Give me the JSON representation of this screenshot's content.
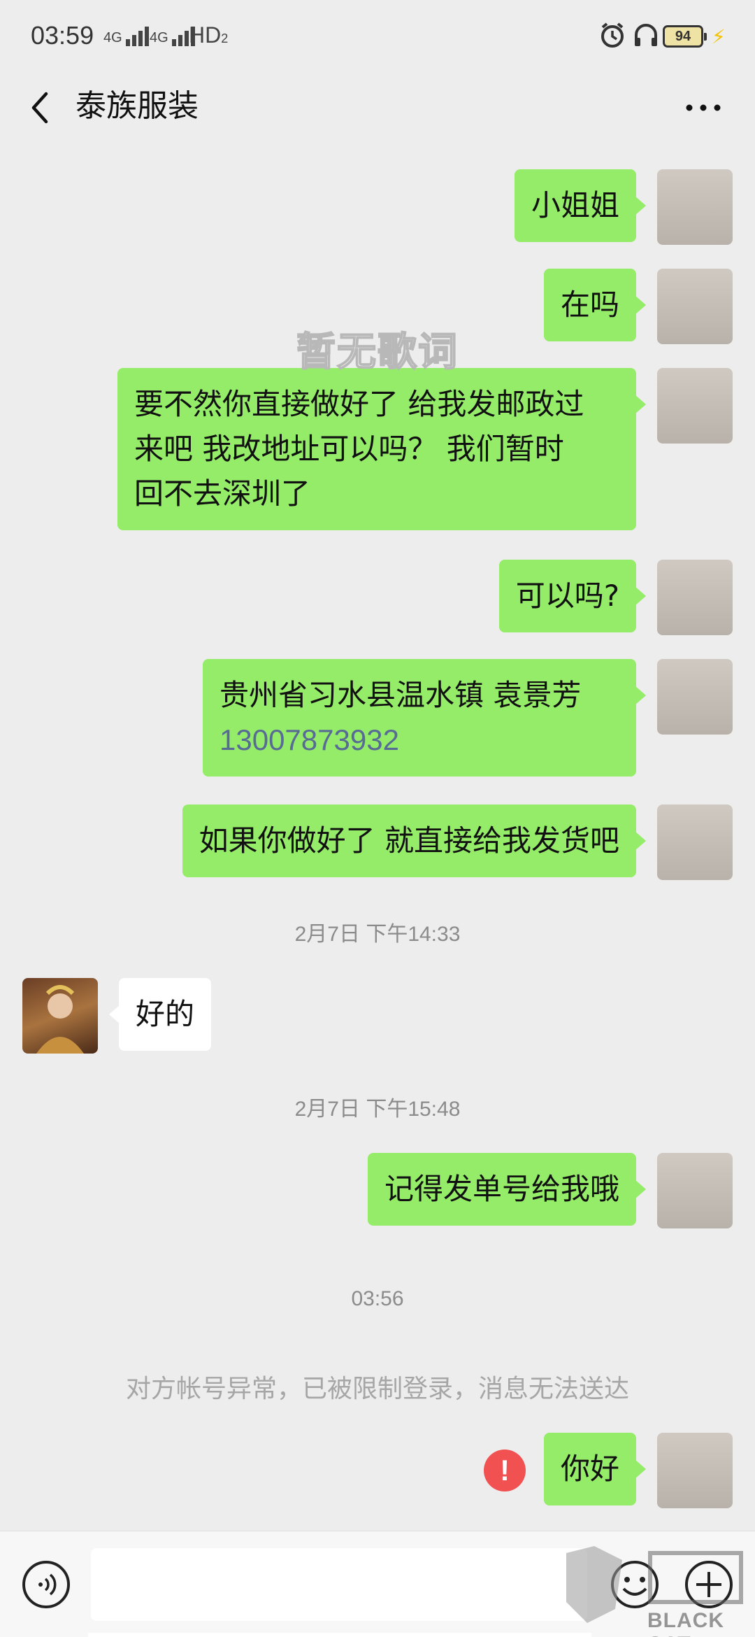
{
  "status_bar": {
    "time": "03:59",
    "network_1": "4G",
    "network_2": "4G",
    "hd": "HD",
    "hd_sub": "2",
    "battery": "94",
    "icons": [
      "alarm-icon",
      "headphones-icon",
      "charging-icon"
    ]
  },
  "header": {
    "title": "泰族服装",
    "back_icon": "chevron-left-icon",
    "more_icon": "more-dots-icon"
  },
  "overlay": {
    "lyric_text": "暂无歌词"
  },
  "messages": [
    {
      "sender": "self",
      "text": "小姐姐"
    },
    {
      "sender": "self",
      "text": "在吗"
    },
    {
      "sender": "self",
      "lines": [
        "要不然你直接做好了  给我发邮政过",
        "来吧  我改地址可以吗？  我们暂时",
        "回不去深圳了"
      ]
    },
    {
      "sender": "self",
      "text": "可以吗?"
    },
    {
      "sender": "self",
      "line1": "贵州省习水县温水镇  袁景芳",
      "phone": "13007873932"
    },
    {
      "sender": "self",
      "text": "如果你做好了 就直接给我发货吧"
    },
    {
      "type": "timestamp",
      "text": "2月7日 下午14:33"
    },
    {
      "sender": "other",
      "text": "好的"
    },
    {
      "type": "timestamp",
      "text": "2月7日 下午15:48"
    },
    {
      "sender": "self",
      "text": "记得发单号给我哦"
    },
    {
      "type": "timestamp",
      "text": "03:56"
    },
    {
      "type": "system",
      "text": "对方帐号异常，已被限制登录，消息无法送达"
    },
    {
      "sender": "self",
      "text": "你好",
      "status": "failed",
      "status_icon": "!"
    }
  ],
  "input_bar": {
    "voice_icon": "voice-icon",
    "input_value": "",
    "emoji_icon": "emoji-icon",
    "plus_icon": "plus-icon"
  },
  "watermark": {
    "text": "BLACK CAT"
  },
  "colors": {
    "self_bubble": "#95ec69",
    "other_bubble": "#ffffff",
    "background": "#ededed",
    "link": "#576b95",
    "error": "#f15151"
  }
}
